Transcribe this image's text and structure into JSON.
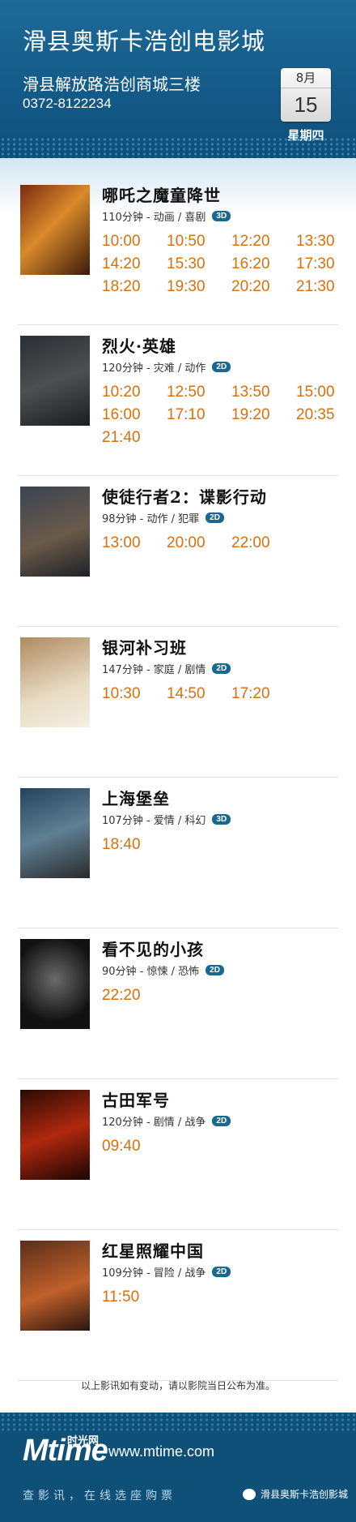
{
  "header": {
    "cinema_name": "滑县奥斯卡浩创电影城",
    "address": "滑县解放路浩创商城三楼",
    "phone": "0372-8122234",
    "month": "8月",
    "day": "15",
    "weekday": "星期四"
  },
  "movies": [
    {
      "title": "哪吒之魔童降世",
      "meta": "110分钟 - 动画 / 喜剧",
      "format": "3D",
      "times": [
        "10:00",
        "10:50",
        "12:20",
        "13:30",
        "14:20",
        "15:30",
        "16:20",
        "17:30",
        "18:20",
        "19:30",
        "20:20",
        "21:30"
      ]
    },
    {
      "title": "烈火·英雄",
      "meta": "120分钟 - 灾难 / 动作",
      "format": "2D",
      "times": [
        "10:20",
        "12:50",
        "13:50",
        "15:00",
        "16:00",
        "17:10",
        "19:20",
        "20:35",
        "21:40"
      ]
    },
    {
      "title": "使徒行者2：谍影行动",
      "meta": "98分钟 - 动作 / 犯罪",
      "format": "2D",
      "times": [
        "13:00",
        "20:00",
        "22:00"
      ]
    },
    {
      "title": "银河补习班",
      "meta": "147分钟 - 家庭 / 剧情",
      "format": "2D",
      "times": [
        "10:30",
        "14:50",
        "17:20"
      ]
    },
    {
      "title": "上海堡垒",
      "meta": "107分钟 - 爱情 / 科幻",
      "format": "3D",
      "times": [
        "18:40"
      ]
    },
    {
      "title": "看不见的小孩",
      "meta": "90分钟 - 惊悚 / 恐怖",
      "format": "2D",
      "times": [
        "22:20"
      ]
    },
    {
      "title": "古田军号",
      "meta": "120分钟 - 剧情 / 战争",
      "format": "2D",
      "times": [
        "09:40"
      ]
    },
    {
      "title": "红星照耀中国",
      "meta": "109分钟 - 冒险 / 战争",
      "format": "2D",
      "times": [
        "11:50"
      ]
    }
  ],
  "notice": "以上影讯如有变动，请以影院当日公布为准。",
  "footer": {
    "logo_text": "Mtime",
    "logo_cn": "时光网",
    "url": "www.mtime.com",
    "slogan": "查影讯，在线选座购票",
    "wechat_account": "滑县奥斯卡浩创影城"
  },
  "colors": {
    "header_bg": "#0e4f7b",
    "time_orange": "#d96f0d",
    "tag_blue": "#1a6890"
  }
}
